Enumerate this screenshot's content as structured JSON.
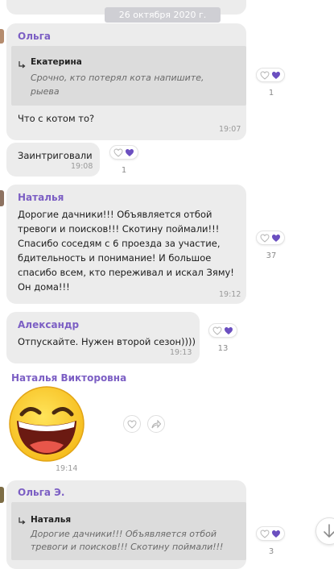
{
  "date_separator": "26 октября 2020 г.",
  "messages": [
    {
      "author": "Ольга",
      "reply_to": {
        "author": "Екатерина",
        "text_line1": "Срочно, кто потерял кота напишите,",
        "text_line2": "рыева"
      },
      "text": "Что с котом то?",
      "time": "19:07",
      "reaction_count": "1"
    },
    {
      "text": "Заинтриговали",
      "time": "19:08",
      "reaction_count": "1"
    },
    {
      "author": "Наталья",
      "lines": [
        "Дорогие дачники!!! Объявляется отбой",
        "тревоги и поисков!!! Скотину поймали!!!",
        "Спасибо соседям с 6 проезда за участие,",
        "бдительность и понимание! И большое",
        "спасибо всем, кто переживал и искал Зяму!",
        "Он дома!!!"
      ],
      "time": "19:12",
      "reaction_count": "37"
    },
    {
      "author": "Александр",
      "text": "Отпускайте. Нужен второй сезон))))",
      "time": "19:13",
      "reaction_count": "13"
    },
    {
      "author": "Наталья Викторовна",
      "sticker": "laughing-emoji",
      "time": "19:14"
    },
    {
      "author": "Ольга Э.",
      "reply_to": {
        "author": "Наталья",
        "text_line1": "Дорогие дачники!!! Объявляется отбой",
        "text_line2": "тревоги и поисков!!! Скотину поймали!!!"
      },
      "reaction_count": "3"
    }
  ],
  "colors": {
    "accent": "#7c5fc4",
    "bubble": "#ececec",
    "quote": "#dcdcdc",
    "heart_filled": "#6b4fc0"
  },
  "icons": [
    "heart-outline-icon",
    "heart-filled-icon",
    "share-icon",
    "scroll-down-icon",
    "reply-arrow-icon"
  ]
}
